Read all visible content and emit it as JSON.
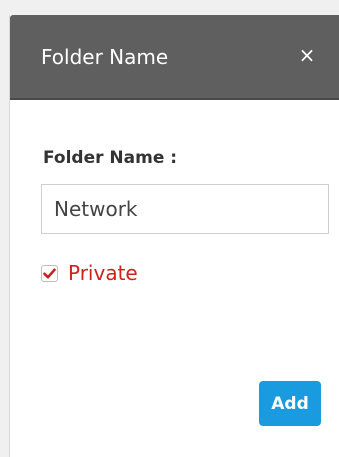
{
  "dialog": {
    "title": "Folder Name",
    "close_icon": "close-icon",
    "close_glyph": "×"
  },
  "form": {
    "folder_name_label": "Folder Name :",
    "folder_name_value": "Network",
    "private_label": "Private",
    "private_checked": true,
    "submit_label": "Add"
  },
  "colors": {
    "header_bg": "#5f5f5f",
    "private_text": "#d0211e",
    "checkmark": "#c8201d",
    "button_bg": "#1a9be0"
  }
}
